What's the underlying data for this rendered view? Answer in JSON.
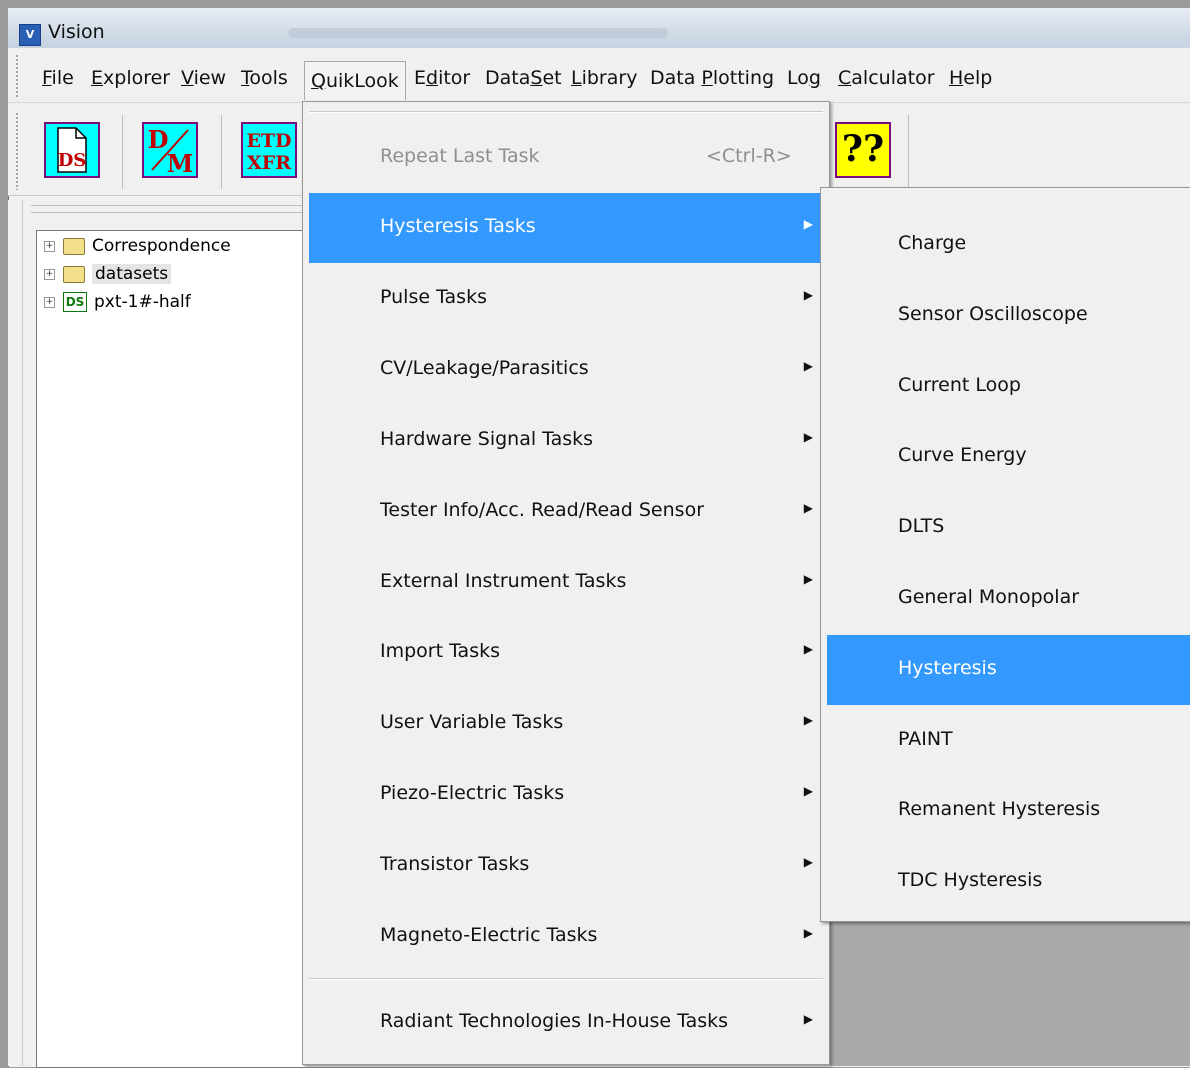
{
  "window": {
    "title": "Vision",
    "icon": "vision-app-icon"
  },
  "menubar": {
    "items": [
      {
        "label": "File",
        "accel": "F"
      },
      {
        "label": "Explorer",
        "accel": "E"
      },
      {
        "label": "View",
        "accel": "V"
      },
      {
        "label": "Tools",
        "accel": "T"
      },
      {
        "label": "QuikLook",
        "accel": "Q"
      },
      {
        "label": "Editor",
        "accel": "d"
      },
      {
        "label": "DataSet",
        "accel": "S"
      },
      {
        "label": "Library",
        "accel": "L"
      },
      {
        "label": "Data Plotting",
        "accel": "P"
      },
      {
        "label": "Log",
        "accel": "g"
      },
      {
        "label": "Calculator",
        "accel": "C"
      },
      {
        "label": "Help",
        "accel": "H"
      }
    ]
  },
  "toolbar": {
    "buttons": [
      {
        "name": "ds-document-button",
        "text1": "DS"
      },
      {
        "name": "dm-button",
        "text1": "D",
        "text2": "M"
      },
      {
        "name": "etd-xfr-button",
        "text1": "ETD",
        "text2": "XFR"
      }
    ],
    "help_glyph": "??"
  },
  "tree": {
    "items": [
      {
        "label": "Correspondence",
        "type": "folder"
      },
      {
        "label": "datasets",
        "type": "folder"
      },
      {
        "label": "pxt-1#-half",
        "type": "dataset",
        "badge": "DS"
      }
    ]
  },
  "quiklook_menu": {
    "repeat": {
      "label": "Repeat Last Task",
      "shortcut": "<Ctrl-R>"
    },
    "items": [
      "Hysteresis Tasks",
      "Pulse Tasks",
      "CV/Leakage/Parasitics",
      "Hardware Signal Tasks",
      "Tester Info/Acc. Read/Read Sensor",
      "External Instrument Tasks",
      "Import Tasks",
      "User Variable Tasks",
      "Piezo-Electric Tasks",
      "Transistor Tasks",
      "Magneto-Electric Tasks"
    ],
    "bottom_item": "Radiant Technologies In-House Tasks",
    "highlighted": "Hysteresis Tasks"
  },
  "hysteresis_submenu": {
    "items": [
      "Charge",
      "Sensor Oscilloscope",
      "Current Loop",
      "Curve Energy",
      "DLTS",
      "General Monopolar",
      "Hysteresis",
      "PAINT",
      "Remanent Hysteresis",
      "TDC Hysteresis"
    ],
    "highlighted": "Hysteresis"
  },
  "colors": {
    "highlight": "#3399ff",
    "toolbar_icon_bg": "#00ffff",
    "help_icon_bg": "#ffff00"
  }
}
